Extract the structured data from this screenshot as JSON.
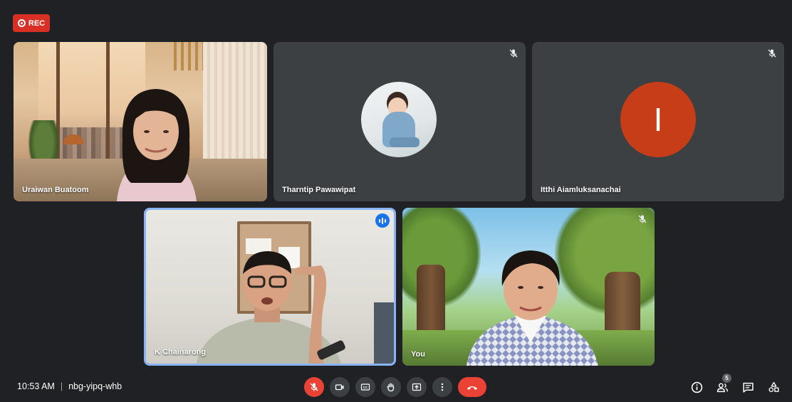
{
  "recording": {
    "label": "REC",
    "color": "#d93025"
  },
  "participants": [
    {
      "name": "Uraiwan Buatoom",
      "muted": false,
      "video": true
    },
    {
      "name": "Tharntip Pawawipat",
      "muted": true,
      "video": false,
      "avatar": "photo"
    },
    {
      "name": "Itthi Aiamluksanachai",
      "muted": true,
      "video": false,
      "avatar_letter": "I",
      "avatar_color": "#c63d17"
    },
    {
      "name": "K Chainarong",
      "muted": false,
      "video": true,
      "speaking": true,
      "highlight_color": "#8ab4f8"
    },
    {
      "name": "You",
      "muted": true,
      "video": true
    }
  ],
  "meeting": {
    "time": "10:53 AM",
    "separator": "|",
    "code": "nbg-yipq-whb"
  },
  "controls": [
    {
      "icon": "mic-off-icon",
      "active_color": "#ea4335"
    },
    {
      "icon": "camera-icon"
    },
    {
      "icon": "captions-icon"
    },
    {
      "icon": "raise-hand-icon"
    },
    {
      "icon": "present-screen-icon"
    },
    {
      "icon": "more-options-icon"
    },
    {
      "icon": "hang-up-icon",
      "active_color": "#ea4335"
    }
  ],
  "tools": {
    "participants_count": "5",
    "items": [
      "info-icon",
      "people-icon",
      "chat-icon",
      "activities-icon"
    ]
  }
}
